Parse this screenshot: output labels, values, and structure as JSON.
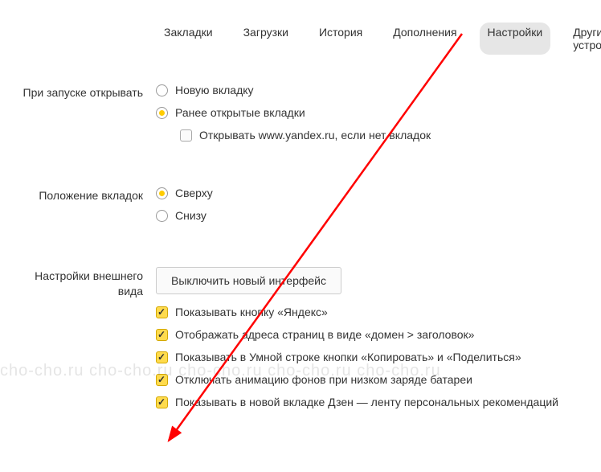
{
  "tabs": {
    "items": [
      "Закладки",
      "Загрузки",
      "История",
      "Дополнения",
      "Настройки",
      "Другие устройства"
    ],
    "active_index": 4
  },
  "sections": {
    "startup": {
      "label": "При запуске открывать",
      "opt_new_tab": "Новую вкладку",
      "opt_prev_tabs": "Ранее открытые вкладки",
      "sub_open_yandex": "Открывать www.yandex.ru, если нет вкладок"
    },
    "tab_position": {
      "label": "Положение вкладок",
      "opt_top": "Сверху",
      "opt_bottom": "Снизу"
    },
    "appearance": {
      "label": "Настройки внешнего вида",
      "btn_disable_new_ui": "Выключить новый интерфейс",
      "chk_yandex_button": "Показывать кнопку «Яндекс»",
      "chk_address_format": "Отображать адреса страниц в виде «домен > заголовок»",
      "chk_smart_line_buttons": "Показывать в Умной строке кнопки «Копировать» и «Поделиться»",
      "chk_disable_anim": "Отключать анимацию фонов при низком заряде батареи",
      "chk_zen_feed": "Показывать в новой вкладке Дзен — ленту персональных рекомендаций"
    }
  },
  "watermark": "cho-cho.ru cho-cho.ru cho-cho.ru cho-cho.ru cho-cho.ru"
}
